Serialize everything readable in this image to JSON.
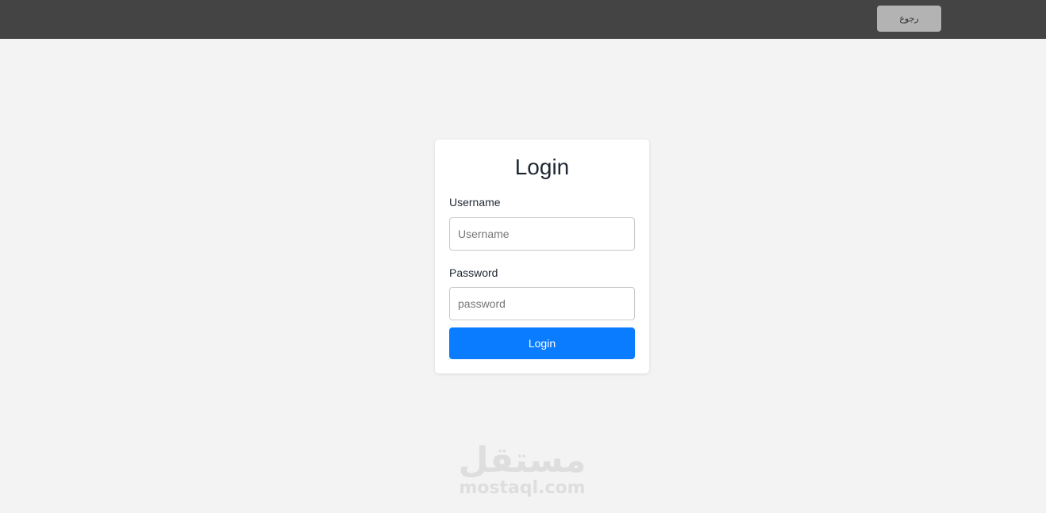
{
  "topbar": {
    "back_label": "رجوع"
  },
  "login": {
    "title": "Login",
    "username_label": "Username",
    "username_placeholder": "Username",
    "username_value": "",
    "password_label": "Password",
    "password_placeholder": "password",
    "password_value": "",
    "submit_label": "Login"
  },
  "watermark": {
    "logo_text": "مستقل",
    "url": "mostaql.com"
  },
  "colors": {
    "topbar_bg": "#444444",
    "page_bg": "#f3f3f3",
    "primary": "#0a7cff",
    "back_button_bg": "#b3b3b3"
  }
}
